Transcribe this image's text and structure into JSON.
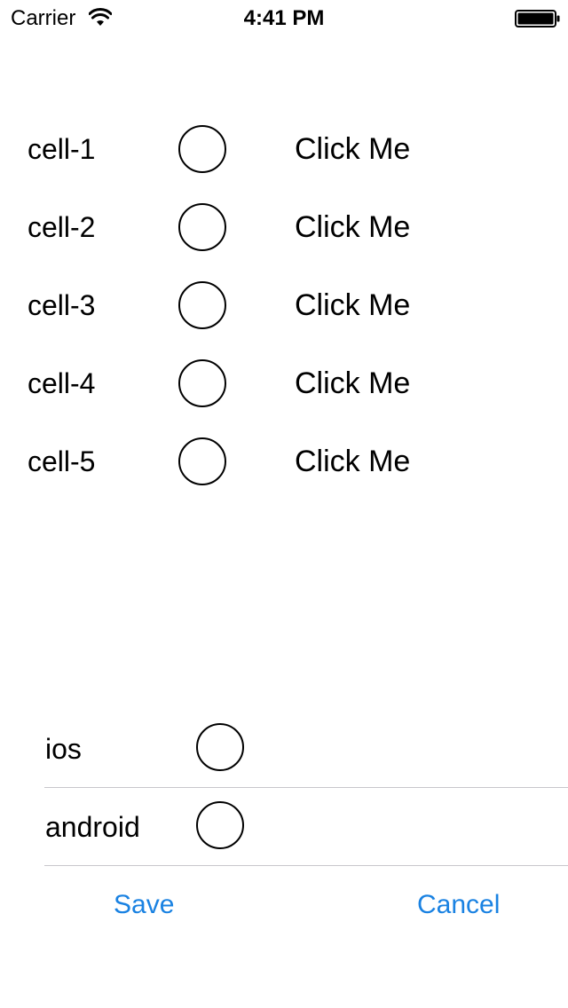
{
  "status_bar": {
    "carrier": "Carrier",
    "time": "4:41 PM",
    "icons": [
      "wifi-icon",
      "battery-icon"
    ]
  },
  "cells": [
    {
      "label": "cell-1",
      "button": "Click Me"
    },
    {
      "label": "cell-2",
      "button": "Click Me"
    },
    {
      "label": "cell-3",
      "button": "Click Me"
    },
    {
      "label": "cell-4",
      "button": "Click Me"
    },
    {
      "label": "cell-5",
      "button": "Click Me"
    }
  ],
  "options": [
    {
      "label": "ios"
    },
    {
      "label": "android"
    }
  ],
  "actions": {
    "save_label": "Save",
    "cancel_label": "Cancel"
  },
  "colors": {
    "accent": "#1a82e2",
    "separator": "#c8c7cc",
    "text": "#000000"
  }
}
